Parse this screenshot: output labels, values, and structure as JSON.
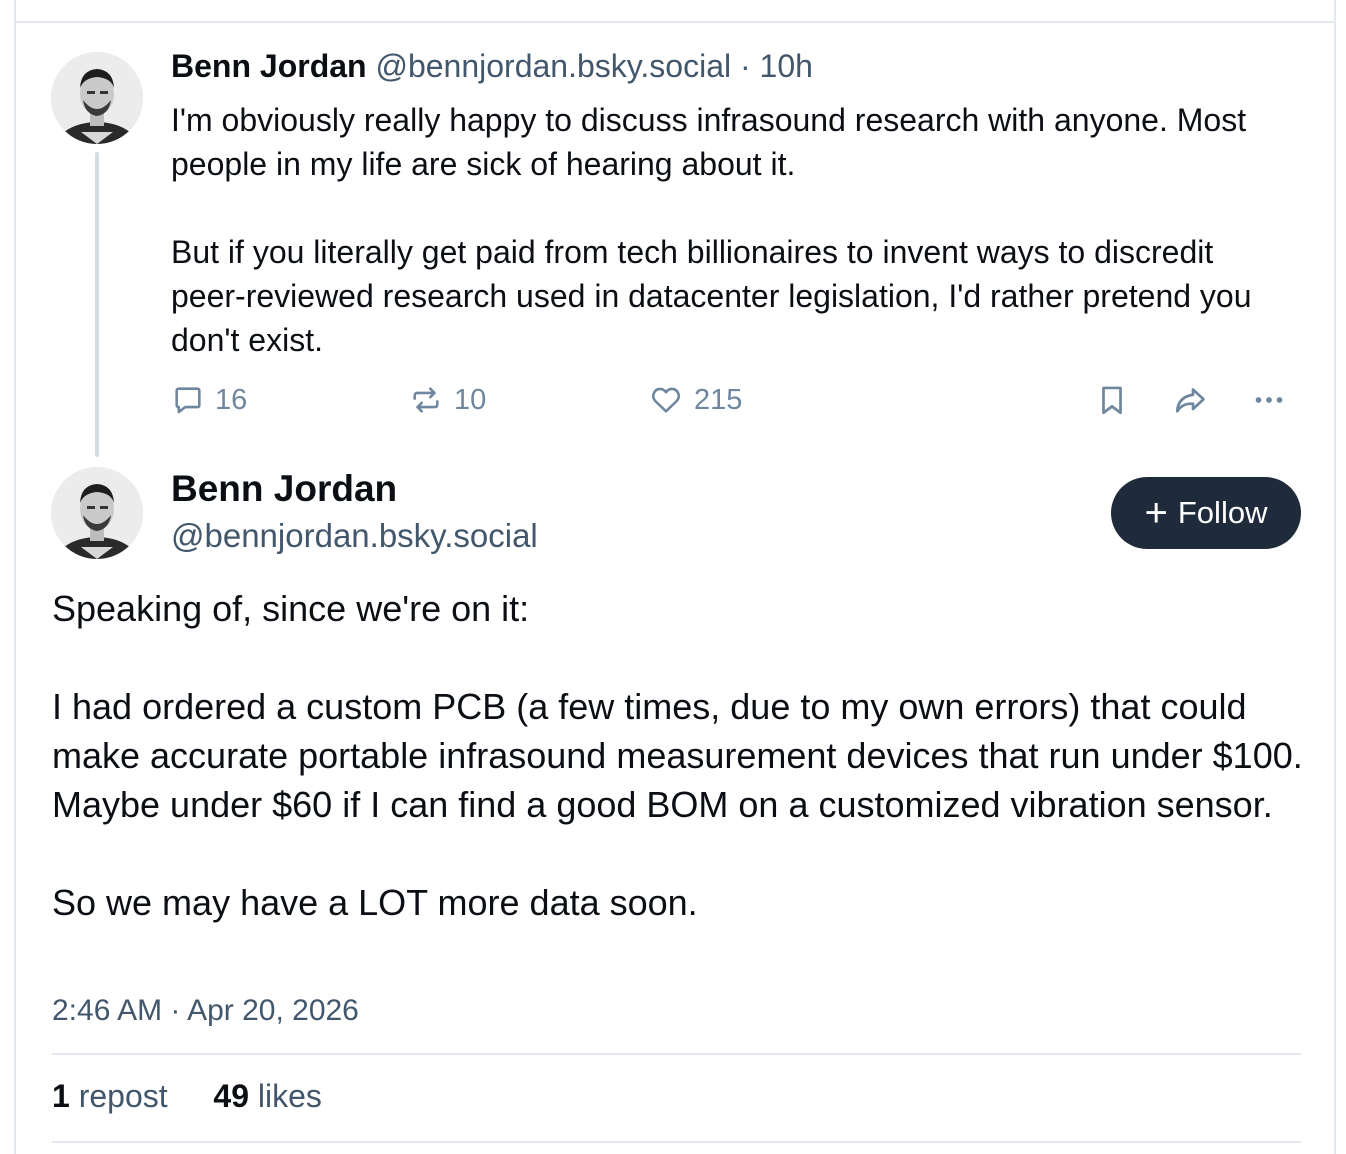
{
  "reply": {
    "author_name": "Benn Jordan",
    "author_handle": "@bennjordan.bsky.social",
    "time_ago": "· 10h",
    "paragraphs": [
      "I'm obviously really happy to discuss infrasound research with anyone. Most people in my life are sick of hearing about it.",
      "But if you literally get paid from tech billionaires to invent ways to discredit peer-reviewed research used in datacenter legislation, I'd rather pretend you don't exist."
    ],
    "actions": {
      "reply_count": "16",
      "repost_count": "10",
      "like_count": "215",
      "icons": [
        "reply-icon",
        "repost-icon",
        "like-icon",
        "bookmark-icon",
        "share-icon",
        "more-icon"
      ]
    }
  },
  "post": {
    "author_name": "Benn Jordan",
    "author_handle": "@bennjordan.bsky.social",
    "follow_label": "Follow",
    "paragraphs": [
      "Speaking of, since we're on it:",
      "I had ordered a custom PCB (a few times, due to my own errors) that could make accurate portable infrasound measurement devices that run under $100. Maybe under $60 if I can find a good BOM on a customized vibration sensor.",
      "So we may have a LOT more data soon."
    ],
    "timestamp": "2:46 AM · Apr 20, 2026",
    "stats": {
      "repost_count": "1",
      "repost_label": "repost",
      "like_count": "49",
      "like_label": "likes"
    }
  },
  "colors": {
    "text": "#0b0f14",
    "muted": "#42576c",
    "icon": "#6f869f",
    "follow_bg": "#1f2b3a",
    "border": "#e3e8ee"
  }
}
